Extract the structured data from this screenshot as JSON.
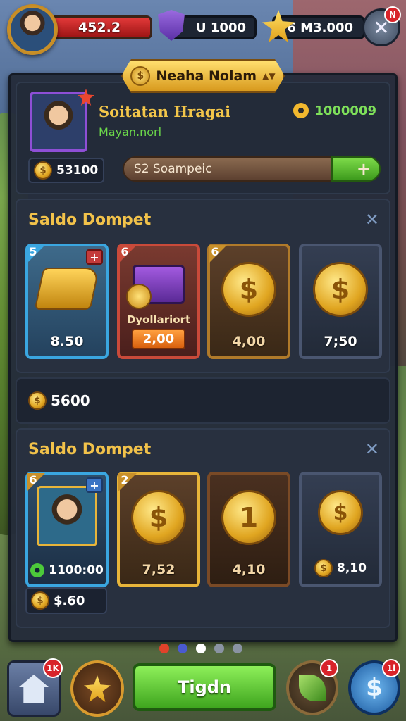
{
  "topbar": {
    "hp_value": "452.2",
    "gem_value": "U 1000",
    "gold_value": "6 M3.000",
    "close_badge": "N"
  },
  "profile": {
    "banner_title": "Neaha Nolam",
    "player_name": "Soitatan Hragai",
    "player_sub": "Mayan.norl",
    "score": "1000009",
    "coins": "53100",
    "progress_label": "S2 Soampeic",
    "add_label": "+"
  },
  "section1": {
    "title": "Saldo Dompet",
    "cards": [
      {
        "level": "5",
        "value": "8.50",
        "plus": "+"
      },
      {
        "level": "6",
        "tag": "Dyollariort",
        "value": "2,00"
      },
      {
        "level": "6",
        "value": "4,00"
      },
      {
        "value": "7;50"
      }
    ]
  },
  "wallet": {
    "value": "5600"
  },
  "section2": {
    "title": "Saldo Dompet",
    "cards": [
      {
        "level": "6",
        "value": "1100:00",
        "plus": "+"
      },
      {
        "level": "2",
        "value": "7,52"
      },
      {
        "value": "4,10"
      },
      {
        "value": "8,10"
      }
    ],
    "small_value": "$.60"
  },
  "bottom": {
    "main_label": "Tigdn",
    "home_badge": "1K",
    "leaf_badge": "1",
    "dollar_badge": "1l"
  },
  "colors": {
    "gold": "#f2c24a",
    "panel": "#242c3a",
    "green": "#3ea41e",
    "red": "#d8232a",
    "purple": "#8e4fd6",
    "blue": "#3aa6e0"
  }
}
